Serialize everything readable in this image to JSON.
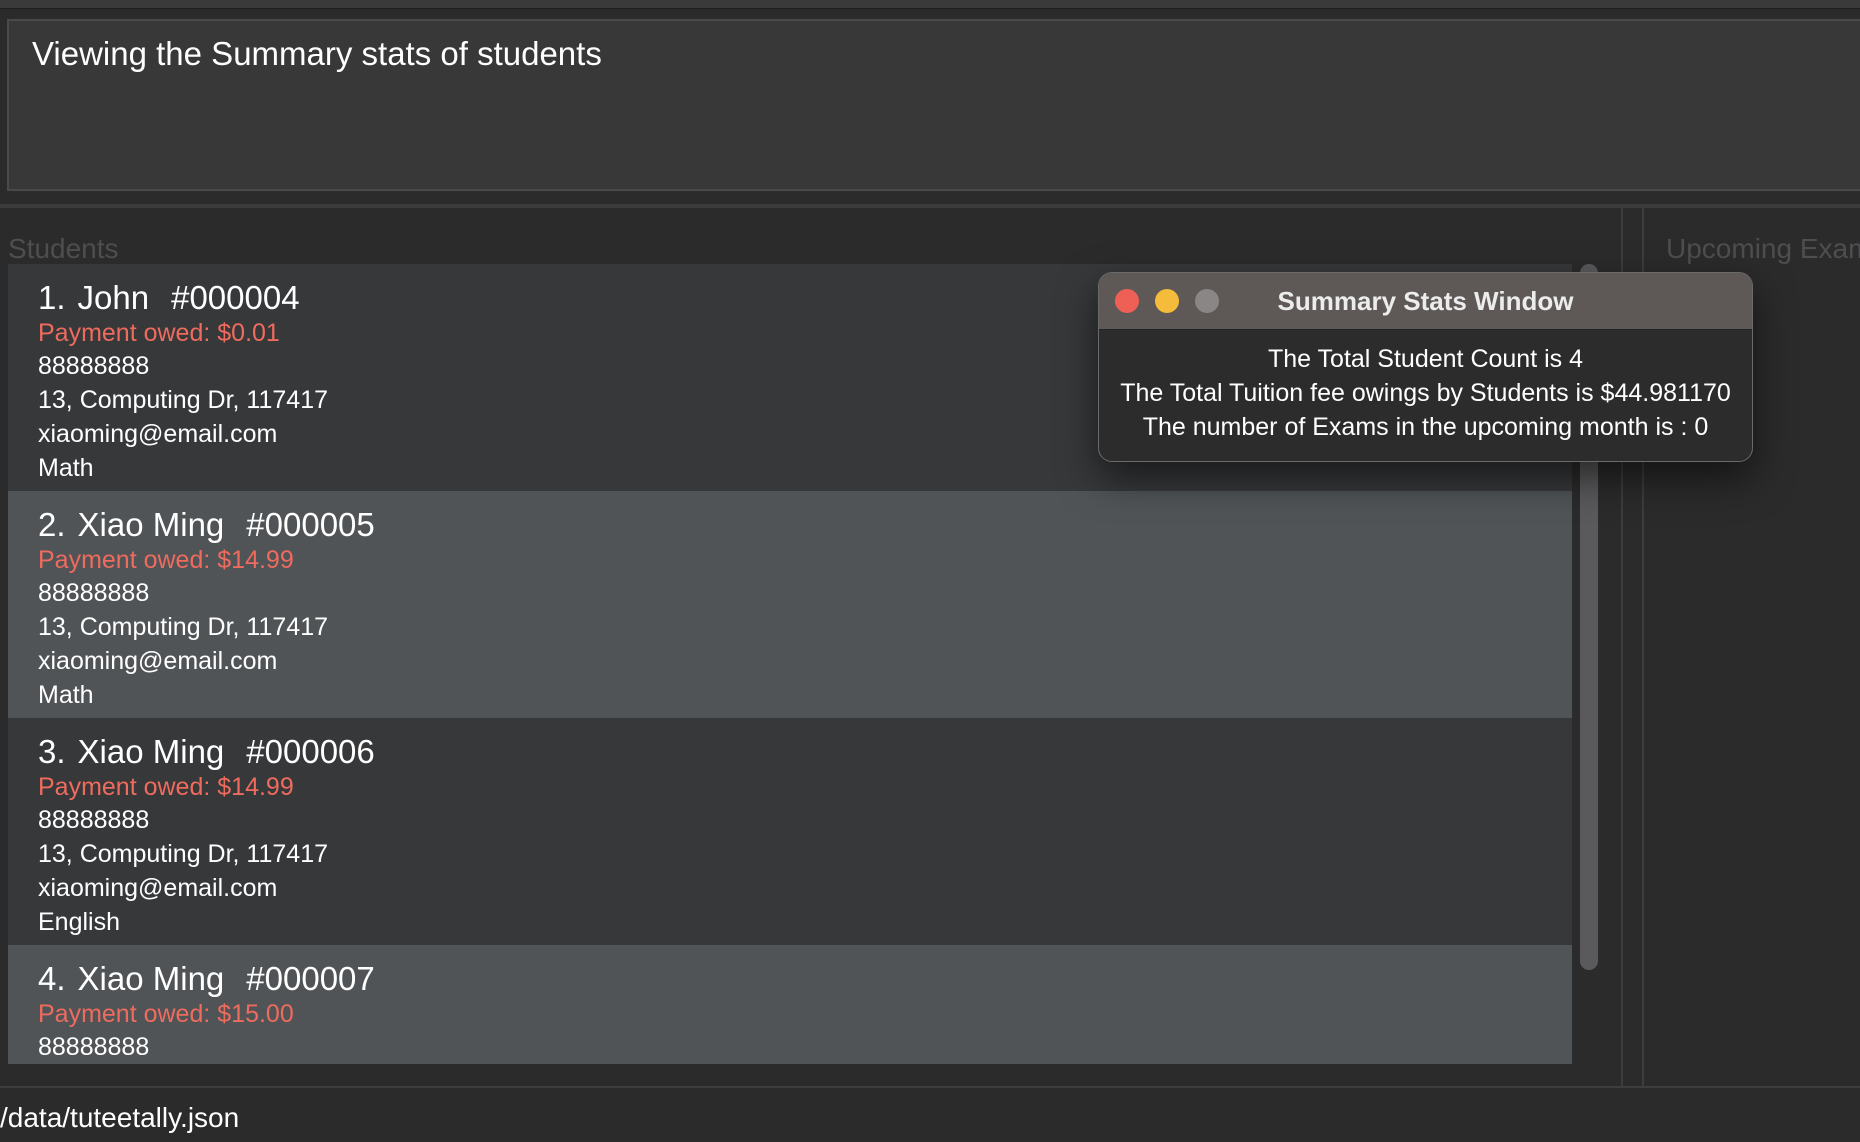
{
  "result": {
    "text": "Viewing the Summary stats of students"
  },
  "students_panel": {
    "heading": "Students",
    "students": [
      {
        "index": "1.",
        "name": "John",
        "id": "#000004",
        "payment": "Payment owed: $0.01",
        "phone": "88888888",
        "address": "13, Computing Dr, 117417",
        "email": "xiaoming@email.com",
        "subject": "Math"
      },
      {
        "index": "2.",
        "name": "Xiao Ming",
        "id": "#000005",
        "payment": "Payment owed: $14.99",
        "phone": "88888888",
        "address": "13, Computing Dr, 117417",
        "email": "xiaoming@email.com",
        "subject": "Math"
      },
      {
        "index": "3.",
        "name": "Xiao Ming",
        "id": "#000006",
        "payment": "Payment owed: $14.99",
        "phone": "88888888",
        "address": "13, Computing Dr, 117417",
        "email": "xiaoming@email.com",
        "subject": "English"
      },
      {
        "index": "4.",
        "name": "Xiao Ming",
        "id": "#000007",
        "payment": "Payment owed: $15.00",
        "phone": "88888888",
        "address": "",
        "email": "",
        "subject": ""
      }
    ]
  },
  "exams_panel": {
    "heading": "Upcoming Exam"
  },
  "status_bar": {
    "path": "/data/tuteetally.json"
  },
  "summary_window": {
    "title": "Summary Stats Window",
    "lines": [
      "The Total Student Count is 4",
      "The Total Tuition fee owings by Students is $44.981170",
      "The number of Exams in the upcoming month is : 0"
    ]
  },
  "colors": {
    "background": "#2b2b2c",
    "card_dark": "#37383a",
    "card_light": "#505457",
    "payment_owed": "#ee6b5e",
    "heading_muted": "#4e4e50",
    "window_titlebar": "#5e5957",
    "close_button": "#ee5f56",
    "minimize_button": "#f5bb3a",
    "zoom_button_inactive": "#8a8685"
  }
}
